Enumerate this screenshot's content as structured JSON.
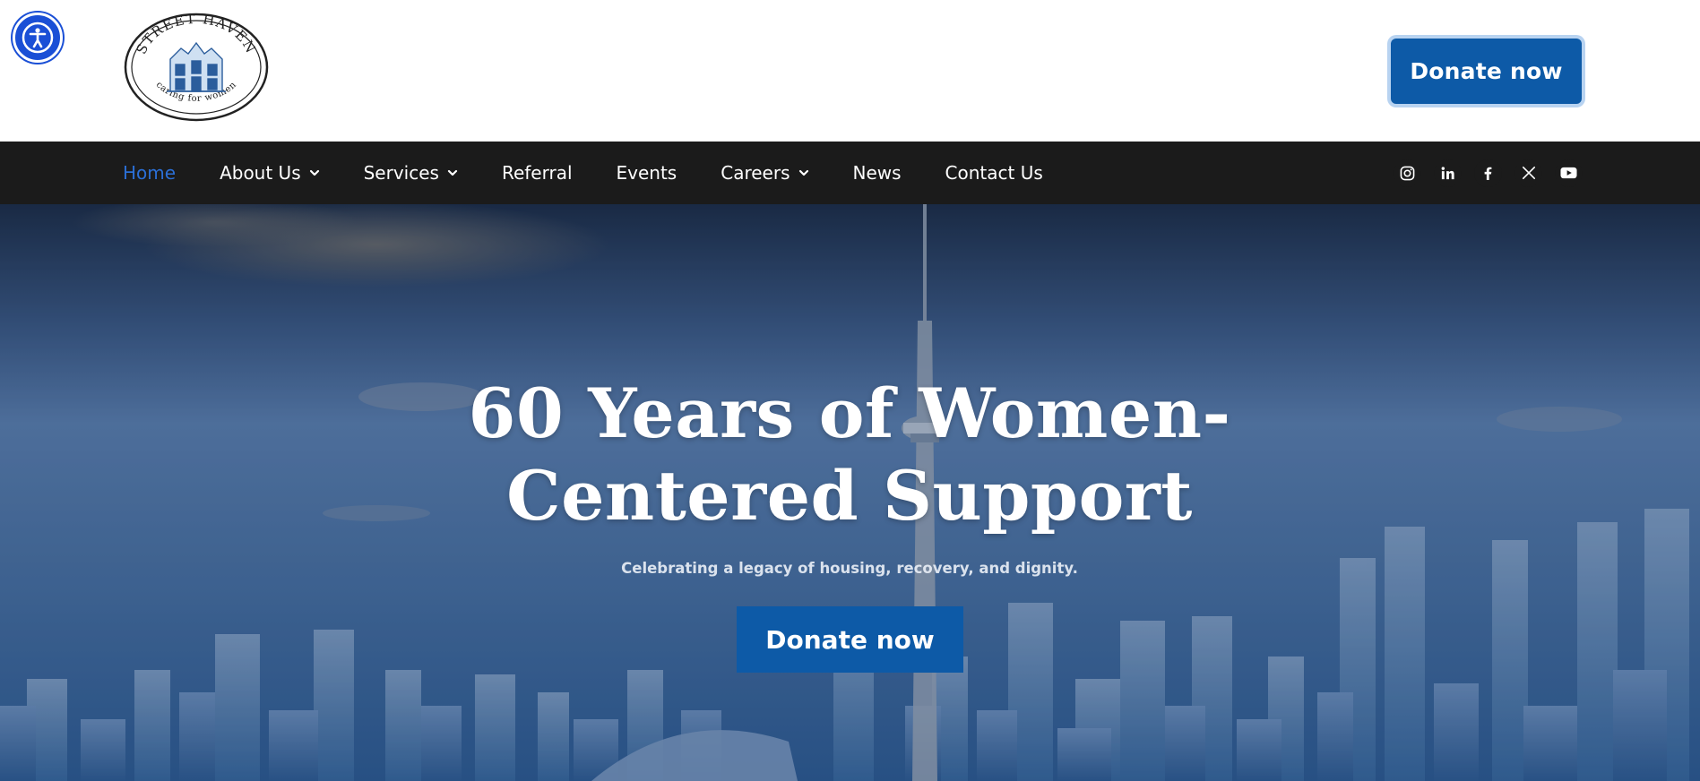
{
  "accessibility": {
    "icon": "accessibility-icon"
  },
  "header": {
    "logo": {
      "top_text": "STREET HAVEN",
      "bottom_text": "caring for women"
    },
    "donate_label": "Donate now"
  },
  "nav": {
    "items": [
      {
        "label": "Home",
        "active": true,
        "has_dropdown": false
      },
      {
        "label": "About Us",
        "active": false,
        "has_dropdown": true
      },
      {
        "label": "Services",
        "active": false,
        "has_dropdown": true
      },
      {
        "label": "Referral",
        "active": false,
        "has_dropdown": false
      },
      {
        "label": "Events",
        "active": false,
        "has_dropdown": false
      },
      {
        "label": "Careers",
        "active": false,
        "has_dropdown": true
      },
      {
        "label": "News",
        "active": false,
        "has_dropdown": false
      },
      {
        "label": "Contact Us",
        "active": false,
        "has_dropdown": false
      }
    ],
    "socials": [
      "instagram-icon",
      "linkedin-icon",
      "facebook-icon",
      "x-icon",
      "youtube-icon"
    ]
  },
  "hero": {
    "title_line1": "60 Years of Women-",
    "title_line2": "Centered Support",
    "subtitle": "Celebrating a legacy of housing, recovery, and dignity.",
    "donate_label": "Donate now"
  },
  "colors": {
    "brand_blue": "#0d5aa7",
    "nav_bg": "#1b1b1b",
    "nav_active": "#2b6fd6",
    "a11y_blue": "#1a4fd6"
  }
}
